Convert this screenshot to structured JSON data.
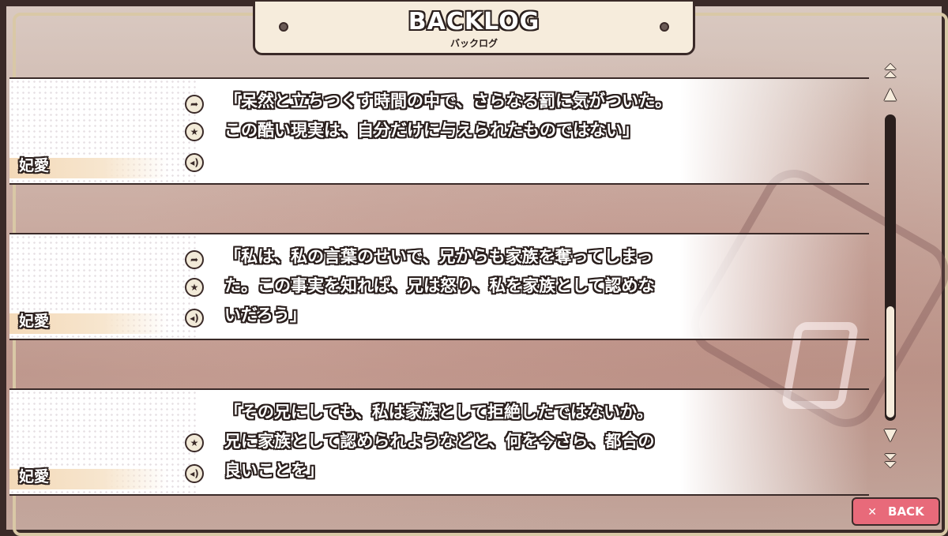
{
  "header": {
    "title": "BACKLOG",
    "subtitle": "バックログ"
  },
  "entries": [
    {
      "speaker": "妃愛",
      "lines": [
        "「呆然と立ちつくす時間の中で、さらなる罰に気がついた。",
        "この酷い現実は、自分だけに与えられたものではない」",
        ""
      ],
      "icons": [
        "jump-icon",
        "star-icon",
        "voice-icon"
      ]
    },
    {
      "speaker": "妃愛",
      "lines": [
        "「私は、私の言葉のせいで、兄からも家族を奪ってしまっ",
        "た。この事実を知れば、兄は怒り、私を家族として認めな",
        "いだろう」"
      ],
      "icons": [
        "jump-icon",
        "star-icon",
        "voice-icon"
      ]
    },
    {
      "speaker": "妃愛",
      "lines": [
        "「その兄にしても、私は家族として拒絶したではないか。",
        "兄に家族として認められようなどと、何を今さら、都合の",
        "良いことを」"
      ],
      "icons": [
        "star-icon",
        "voice-icon"
      ]
    }
  ],
  "scrollbar": {
    "thumb_fraction_start": 0.62,
    "thumb_fraction_end": 1.0
  },
  "back_button": {
    "label": "BACK",
    "icon": "close-icon",
    "color": "#e86a7a"
  },
  "colors": {
    "frame": "#3a2a28",
    "panel": "#f6ecdc"
  }
}
